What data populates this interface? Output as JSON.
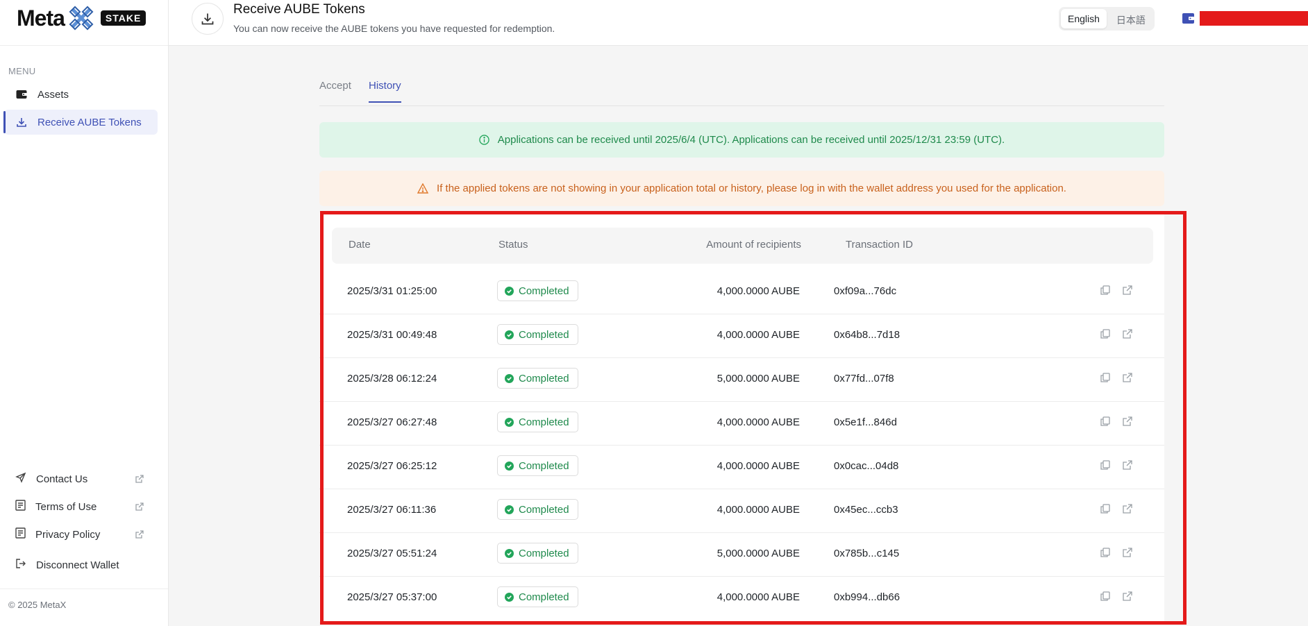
{
  "brand": {
    "word": "Meta",
    "badge": "STAKE"
  },
  "sidebar": {
    "menu_label": "MENU",
    "items": [
      {
        "label": "Assets",
        "icon": "wallet-icon"
      },
      {
        "label": "Receive AUBE Tokens",
        "icon": "download-icon",
        "active": true
      }
    ],
    "footer": [
      {
        "label": "Contact Us",
        "icon": "send-icon"
      },
      {
        "label": "Terms of Use",
        "icon": "document-icon"
      },
      {
        "label": "Privacy Policy",
        "icon": "document-icon"
      },
      {
        "label": "Disconnect Wallet",
        "icon": "logout-icon"
      }
    ],
    "copyright": "© 2025 MetaX"
  },
  "header": {
    "title": "Receive AUBE Tokens",
    "subtitle": "You can now receive the AUBE tokens you have requested for redemption.",
    "languages": [
      "English",
      "日本語"
    ],
    "active_language": "English"
  },
  "tabs": [
    {
      "label": "Accept"
    },
    {
      "label": "History",
      "active": true
    }
  ],
  "alerts": {
    "info": "Applications can be received until 2025/6/4 (UTC). Applications can be received until 2025/12/31 23:59 (UTC).",
    "warning": "If the applied tokens are not showing in your application total or history, please log in with the wallet address you used for the application."
  },
  "table": {
    "columns": [
      "Date",
      "Status",
      "Amount of recipients",
      "Transaction ID"
    ],
    "rows": [
      {
        "date": "2025/3/31 01:25:00",
        "status": "Completed",
        "amount": "4,000.0000 AUBE",
        "tx": "0xf09a...76dc"
      },
      {
        "date": "2025/3/31 00:49:48",
        "status": "Completed",
        "amount": "4,000.0000 AUBE",
        "tx": "0x64b8...7d18"
      },
      {
        "date": "2025/3/28 06:12:24",
        "status": "Completed",
        "amount": "5,000.0000 AUBE",
        "tx": "0x77fd...07f8"
      },
      {
        "date": "2025/3/27 06:27:48",
        "status": "Completed",
        "amount": "4,000.0000 AUBE",
        "tx": "0x5e1f...846d"
      },
      {
        "date": "2025/3/27 06:25:12",
        "status": "Completed",
        "amount": "4,000.0000 AUBE",
        "tx": "0x0cac...04d8"
      },
      {
        "date": "2025/3/27 06:11:36",
        "status": "Completed",
        "amount": "4,000.0000 AUBE",
        "tx": "0x45ec...ccb3"
      },
      {
        "date": "2025/3/27 05:51:24",
        "status": "Completed",
        "amount": "5,000.0000 AUBE",
        "tx": "0x785b...c145"
      },
      {
        "date": "2025/3/27 05:37:00",
        "status": "Completed",
        "amount": "4,000.0000 AUBE",
        "tx": "0xb994...db66"
      }
    ]
  },
  "colors": {
    "accent": "#3f51b5",
    "success": "#1f8a4c",
    "warning": "#c8611c",
    "highlight": "#e41a1a"
  }
}
